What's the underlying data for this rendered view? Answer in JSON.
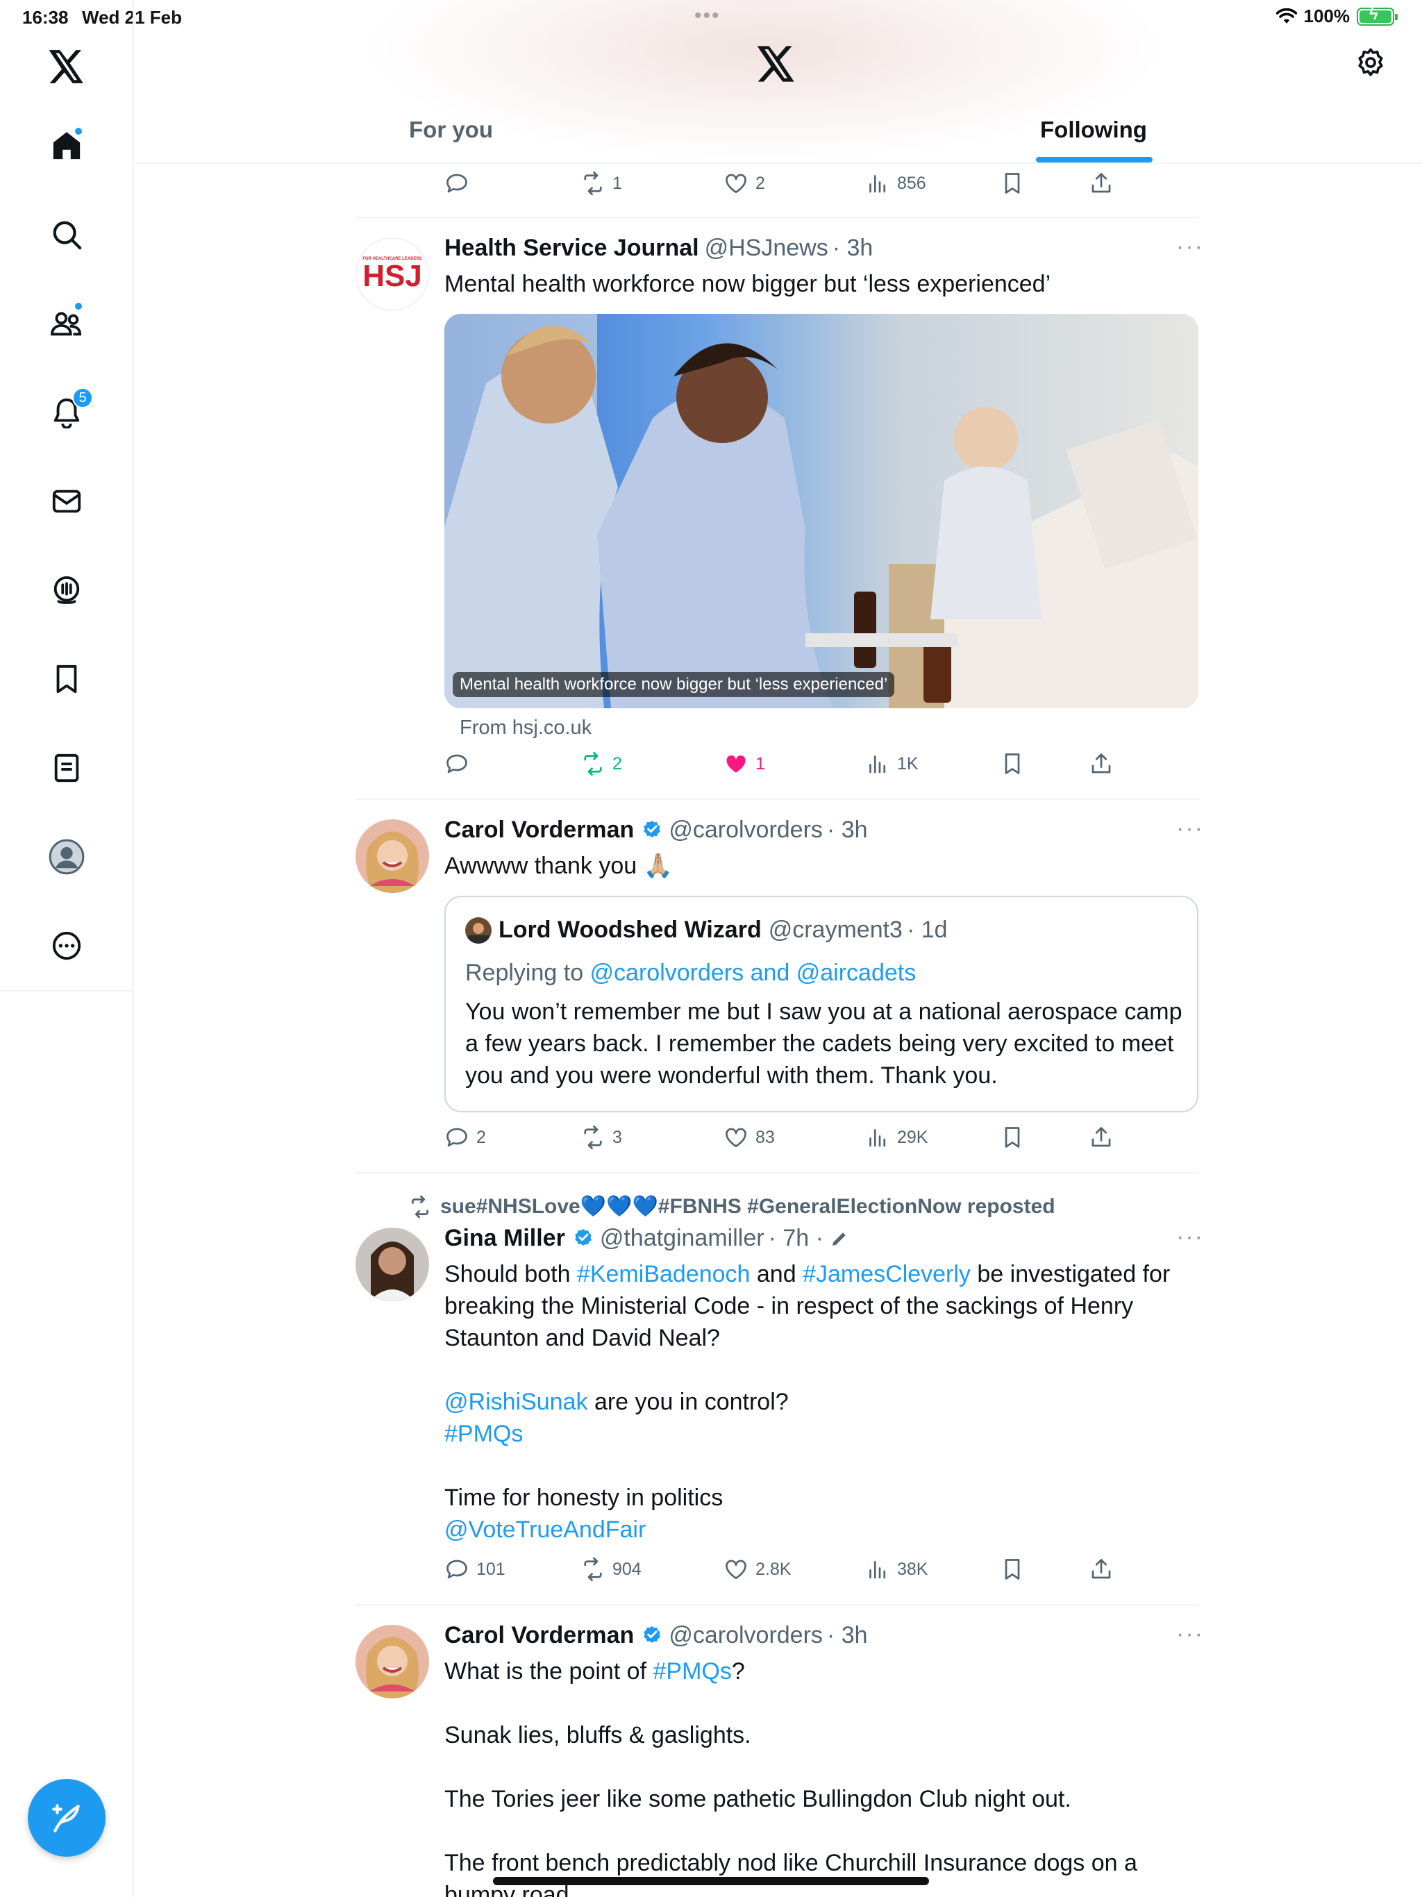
{
  "status_bar": {
    "time": "16:38",
    "date": "Wed 21 Feb",
    "battery": "100%"
  },
  "header": {
    "tabs": [
      "For you",
      "Following"
    ],
    "active_tab": "Following"
  },
  "sidebar": {
    "items": [
      "x-logo",
      "home-icon",
      "search-icon",
      "communities-icon",
      "notifications-icon",
      "messages-icon",
      "spaces-icon",
      "bookmarks-icon",
      "lists-icon",
      "profile-icon",
      "more-icon"
    ],
    "notification_count": "5"
  },
  "colors": {
    "accent": "#1d9bf0",
    "like": "#f91880",
    "repost": "#00ba7c",
    "text": "#0f1419",
    "muted": "#536471"
  },
  "feed": {
    "partial_tweet": {
      "replies": "",
      "reposts": "1",
      "likes": "2",
      "views": "856"
    },
    "tweets": [
      {
        "name": "Health Service Journal",
        "handle": "@HSJnews",
        "time": "· 3h",
        "text": "Mental health workforce now bigger but ‘less experienced’",
        "media_caption": "Mental health workforce now bigger but ‘less experienced’",
        "from": "From hsj.co.uk",
        "avatar_text": "HSJ",
        "avatar_top_text": "FOR HEALTHCARE LEADERS",
        "replies": "",
        "reposts": "2",
        "likes": "1",
        "views": "1K"
      },
      {
        "name": "Carol Vorderman",
        "handle": "@carolvorders",
        "time": "· 3h",
        "text": "Awwww thank you 🙏🏼",
        "quote": {
          "name": "Lord Woodshed Wizard",
          "handle": "@crayment3",
          "time": "· 1d",
          "replying_prefix": "Replying to ",
          "replying_to": "@carolvorders and @aircadets",
          "text": "You won’t remember me but I saw you at a national aerospace camp a few years back. I remember the cadets being very excited to meet you and you were wonderful with them. Thank you."
        },
        "replies": "2",
        "reposts": "3",
        "likes": "83",
        "views": "29K"
      },
      {
        "repost_by": "sue#NHSLove💙💙💙#FBNHS #GeneralElectionNow reposted",
        "name": "Gina Miller",
        "handle": "@thatginamiller",
        "time": "· 7h ·",
        "text_parts": {
          "p1a": "Should both ",
          "p1b": "#KemiBadenoch",
          "p1c": " and ",
          "p1d": "#JamesCleverly",
          "p1e": " be investigated for breaking the Ministerial Code  - in respect of the sackings of Henry Staunton and David Neal?",
          "p2a": "@RishiSunak",
          "p2b": " are you in control?",
          "p3": "#PMQs",
          "p4": "Time for honesty in politics",
          "p5": "@VoteTrueAndFair"
        },
        "replies": "101",
        "reposts": "904",
        "likes": "2.8K",
        "views": "38K"
      },
      {
        "name": "Carol Vorderman",
        "handle": "@carolvorders",
        "time": "· 3h",
        "text_parts": {
          "l1a": "What is the point of ",
          "l1b": "#PMQs",
          "l1c": "?",
          "l2": "Sunak lies, bluffs & gaslights.",
          "l3": "The Tories jeer like some pathetic Bullingdon Club night out.",
          "l4": "The front bench predictably nod like Churchill Insurance dogs on a bumpy road."
        }
      }
    ]
  }
}
